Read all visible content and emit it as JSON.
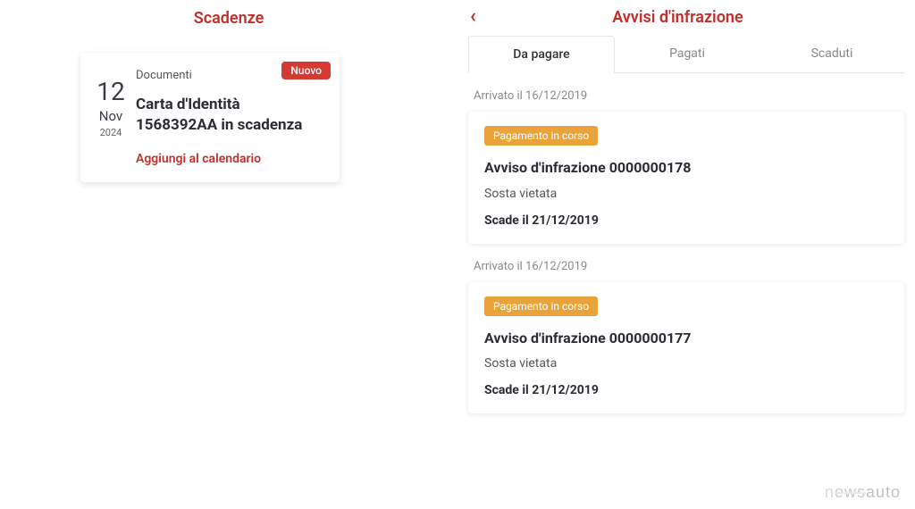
{
  "left": {
    "title": "Scadenze",
    "card": {
      "badge": "Nuovo",
      "date": {
        "day": "12",
        "month": "Nov",
        "year": "2024"
      },
      "category": "Documenti",
      "title": "Carta d'Identità 1568392AA in scadenza",
      "action": "Aggiungi al calendario"
    }
  },
  "right": {
    "title": "Avvisi d'infrazione",
    "tabs": {
      "to_pay": "Da pagare",
      "paid": "Pagati",
      "expired": "Scaduti"
    },
    "items": [
      {
        "arrival": "Arrivato il 16/12/2019",
        "status": "Pagamento in corso",
        "title": "Avviso d'infrazione 0000000178",
        "desc": "Sosta vietata",
        "due": "Scade il 21/12/2019"
      },
      {
        "arrival": "Arrivato il 16/12/2019",
        "status": "Pagamento in corso",
        "title": "Avviso d'infrazione 0000000177",
        "desc": "Sosta vietata",
        "due": "Scade il 21/12/2019"
      }
    ]
  },
  "watermark": {
    "part1": "n",
    "part2": "ews",
    "part3": "auto"
  }
}
